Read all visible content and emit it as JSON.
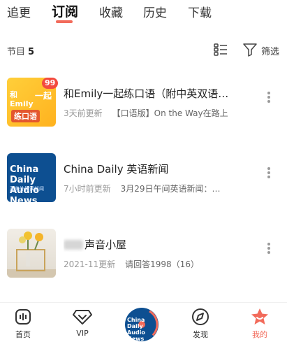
{
  "tabs": [
    {
      "label": "追更"
    },
    {
      "label": "订阅"
    },
    {
      "label": "收藏"
    },
    {
      "label": "历史"
    },
    {
      "label": "下载"
    }
  ],
  "active_tab": "订阅",
  "accent_color": "#f26b5b",
  "count_row": {
    "label": "节目",
    "count": "5",
    "list_view_icon": "list-view-icon",
    "filter_label": "筛选",
    "filter_icon": "filter-icon"
  },
  "items": [
    {
      "title": "和Emily一起练口语（附中英双语…",
      "update": "3天前更新",
      "latest": "【口语版】On the Way在路上",
      "badge": "99",
      "cover_text_a": "和Emily",
      "cover_text_b": "一起",
      "cover_text_c": "练口语"
    },
    {
      "title": "China Daily 英语新闻",
      "update": "7小时前更新",
      "latest": "3月29日午间英语新闻：…",
      "cover_title": "China Daily Audio News",
      "cover_sub": "英美外籍读新闻"
    },
    {
      "title": "声音小屋",
      "update": "2021-11更新",
      "latest": "请回答1998（16）"
    }
  ],
  "bottom_nav": [
    {
      "label": "首页",
      "icon": "home-icon"
    },
    {
      "label": "VIP",
      "icon": "vip-icon"
    },
    {
      "label": "",
      "icon": "now-playing-icon",
      "center_text": "China Daily Audio News"
    },
    {
      "label": "发现",
      "icon": "discover-icon"
    },
    {
      "label": "我的",
      "icon": "profile-icon",
      "active": true
    }
  ]
}
